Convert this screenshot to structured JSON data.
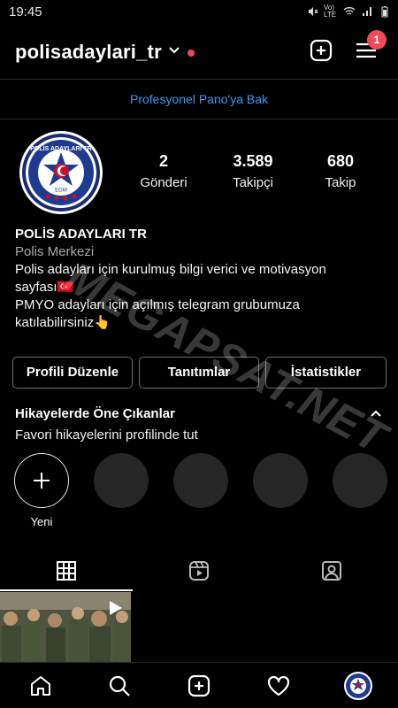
{
  "status_bar": {
    "time": "19:45",
    "network_label": "Vo) LTE"
  },
  "header": {
    "username": "polisadaylari_tr",
    "notification_count": "1"
  },
  "professional_dashboard": {
    "label": "Profesyonel Pano'ya Bak"
  },
  "profile": {
    "stats": [
      {
        "value": "2",
        "label": "Gönderi"
      },
      {
        "value": "3.589",
        "label": "Takipçi"
      },
      {
        "value": "680",
        "label": "Takip"
      }
    ],
    "display_name": "POLİS ADAYLARI TR",
    "category": "Polis Merkezi",
    "bio_lines": [
      "Polis adayları için kurulmuş bilgi verici ve motivasyon",
      "sayfası🇹🇷",
      "PMYO adayları için açılmış telegram grubumuza",
      "katılabilirsiniz👆"
    ],
    "avatar_text": "POLİS ADAYLARI TR",
    "avatar_badge": "EGM"
  },
  "actions": {
    "edit_profile": "Profili Düzenle",
    "promotions": "Tanıtımlar",
    "insights": "İstatistikler"
  },
  "highlights": {
    "title": "Hikayelerde Öne Çıkanlar",
    "subtitle": "Favori hikayelerini profilinde tut",
    "new_label": "Yeni"
  },
  "watermark": "MEGAPSAT.NET",
  "icons": {
    "grid_tab": "grid-icon",
    "reels_tab": "reels-icon",
    "tagged_tab": "tagged-icon",
    "home": "home-icon",
    "search": "search-icon",
    "create": "plus-square-icon",
    "activity": "heart-icon",
    "profile": "avatar"
  },
  "colors": {
    "accent_blue": "#3a9bed",
    "badge_red": "#ed4956",
    "bg": "#000000"
  }
}
